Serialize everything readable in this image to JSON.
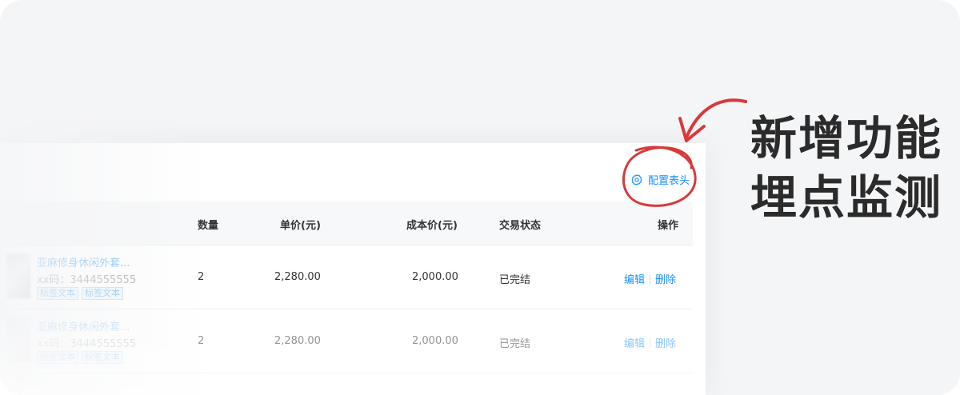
{
  "toolbar": {
    "config_label": "配置表头"
  },
  "table": {
    "columns": [
      "数量",
      "单价(元)",
      "成本价(元)",
      "交易状态",
      "操作"
    ],
    "rows": [
      {
        "name": "亚麻修身休闲外套...",
        "code": "xx码：3444555555",
        "tags": [
          "标签文本",
          "标签文本"
        ],
        "qty": "2",
        "price": "2,280.00",
        "cost": "2,000.00",
        "status": "已完结",
        "edit": "编辑",
        "delete": "删除"
      },
      {
        "name": "亚麻修身休闲外套...",
        "code": "xx码：3444555555",
        "tags": [
          "标签文本",
          "标签文本"
        ],
        "qty": "2",
        "price": "2,280.00",
        "cost": "2,000.00",
        "status": "已完结",
        "edit": "编辑",
        "delete": "删除"
      }
    ]
  },
  "headline": {
    "line1": "新增功能",
    "line2": "埋点监测"
  },
  "colors": {
    "accent": "#1890ff",
    "annotation": "#d8393a",
    "headline": "#2b2b2b"
  },
  "icons": {
    "config": "gear-icon"
  }
}
